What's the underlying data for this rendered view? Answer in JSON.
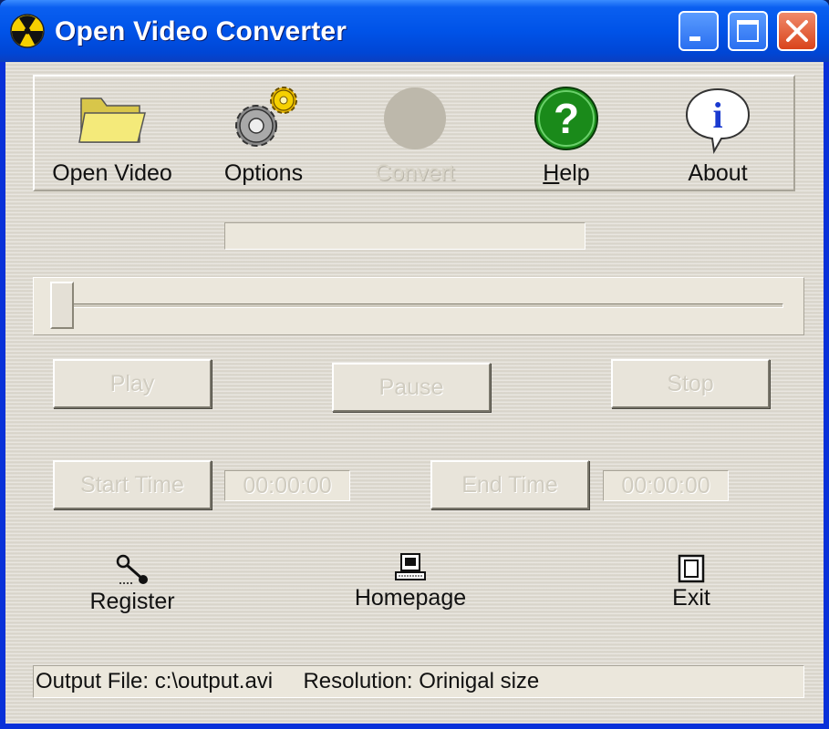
{
  "window": {
    "title": "Open Video Converter",
    "icon": "radiation-icon",
    "controls": [
      "minimize",
      "maximize",
      "close"
    ]
  },
  "toolbar": {
    "items": [
      {
        "label": "Open Video",
        "icon": "folder-icon",
        "enabled": true
      },
      {
        "label": "Options",
        "icon": "gears-icon",
        "enabled": true
      },
      {
        "label": "Convert",
        "icon": "convert-icon",
        "enabled": false
      },
      {
        "label": "Help",
        "icon": "question-icon",
        "enabled": true
      },
      {
        "label": "About",
        "icon": "info-icon",
        "enabled": true
      }
    ]
  },
  "progress": {
    "value": 0
  },
  "seek_slider": {
    "position": 0
  },
  "playback": {
    "play_label": "Play",
    "pause_label": "Pause",
    "stop_label": "Stop"
  },
  "trim": {
    "start_label": "Start Time",
    "start_value": "00:00:00",
    "end_label": "End Time",
    "end_value": "00:00:00"
  },
  "links": {
    "register_label": "Register",
    "homepage_label": "Homepage",
    "exit_label": "Exit"
  },
  "status": {
    "text": "Output File: c:\\output.avi     Resolution: Orinigal size"
  },
  "colors": {
    "titlebar": "#0053e8",
    "client_bg": "#ddd9cf",
    "help_green": "#1a8a1a",
    "info_blue": "#1a3ad0"
  }
}
